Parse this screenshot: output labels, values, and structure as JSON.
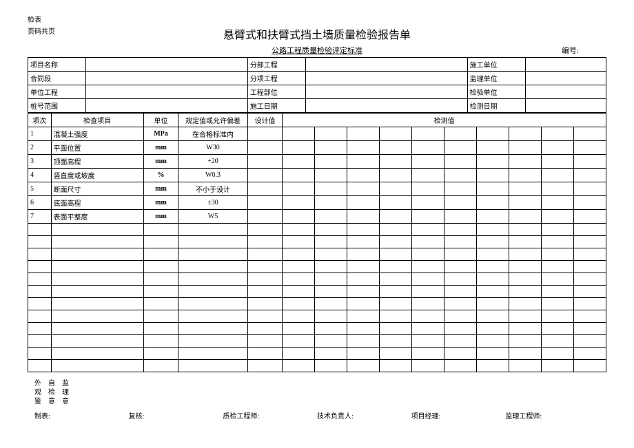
{
  "top": {
    "jianbiao": "检表",
    "yema": "页码共页"
  },
  "title": "悬臂式和扶臂式挡土墙质量检验报告单",
  "subtitle": "公路工程质量检验评定标准",
  "bianhao_label": "编号:",
  "info": {
    "xiangmu_mingcheng": "项目名称",
    "fenbu_gongcheng": "分部工程",
    "shigong_danwei": "施工单位",
    "hetong_duan": "合同段",
    "fenxiang_gongcheng": "分项工程",
    "jianli_danwei": "监理单位",
    "danwei_gongcheng": "单位工程",
    "gongcheng_buwei": "工程部位",
    "jianyan_danwei": "检验单位",
    "zhuanghao_fanwei": "桩号范围",
    "shigong_riqi": "施工日期",
    "jiance_riqi": "检测日期"
  },
  "headers": {
    "xiangci": "项次",
    "jiancha_xiangmu": "检查项目",
    "danwei": "单位",
    "guiding": "规定值或允许偏差",
    "shejizhi": "设计值",
    "jiancezhi": "检测值"
  },
  "rows": [
    {
      "n": "1",
      "item": "混凝土强度",
      "unit": "MPa",
      "spec": "在合格标准内"
    },
    {
      "n": "2",
      "item": "平面位置",
      "unit": "mm",
      "spec": "W30"
    },
    {
      "n": "3",
      "item": "顶面高程",
      "unit": "mm",
      "spec": "+20"
    },
    {
      "n": "4",
      "item": "竖直度或坡度",
      "unit": "%",
      "spec": "W0.3"
    },
    {
      "n": "5",
      "item": "断面尺寸",
      "unit": "mm",
      "spec": "不小于设计"
    },
    {
      "n": "6",
      "item": "底面高程",
      "unit": "mm",
      "spec": "±30"
    },
    {
      "n": "7",
      "item": "表面平整度",
      "unit": "mm",
      "spec": "W5"
    }
  ],
  "footer": {
    "waiguan": "外观鉴",
    "zijian": "自检意",
    "jianli": "监理意",
    "zhibiao": "制表:",
    "fuhe": "复核:",
    "zhijian_gcs": "质检工程师:",
    "jishu_fzr": "技术负责人:",
    "xiangmu_jl": "项目经理:",
    "jianli_gcs": "监理工程师:"
  }
}
